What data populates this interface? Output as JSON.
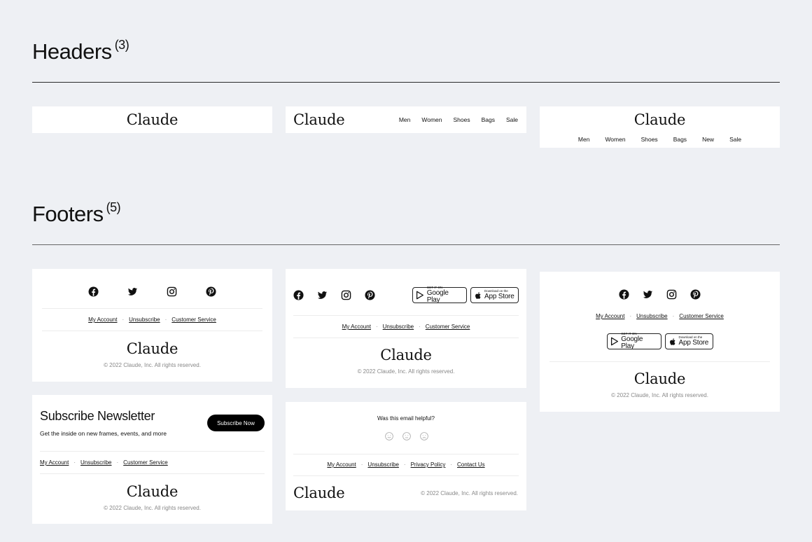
{
  "headers_section": {
    "title": "Headers",
    "count": "(3)"
  },
  "footers_section": {
    "title": "Footers",
    "count": "(5)"
  },
  "brand": "Claude",
  "header2_nav": [
    "Men",
    "Women",
    "Shoes",
    "Bags",
    "Sale"
  ],
  "header3_nav": [
    "Men",
    "Women",
    "Shoes",
    "Bags",
    "New",
    "Sale"
  ],
  "social_icons": [
    "facebook-icon",
    "twitter-icon",
    "instagram-icon",
    "pinterest-icon"
  ],
  "links_basic": [
    "My Account",
    "Unsubscribe",
    "Customer Service"
  ],
  "links_extended": [
    "My Account",
    "Unsubscribe",
    "Privacy Policy",
    "Contact Us"
  ],
  "copyright": "© 2022 Claude, Inc. All rights reserved.",
  "google_play": {
    "small": "GET IT ON",
    "big": "Google Play"
  },
  "app_store": {
    "small": "Download on the",
    "big": "App Store"
  },
  "newsletter": {
    "title": "Subscribe Newsletter",
    "subtitle": "Get the inside on new frames, events, and more",
    "button": "Subscribe Now"
  },
  "feedback": {
    "question": "Was this email helpful?"
  },
  "colors": {
    "background": "#eef0f4",
    "card": "#ffffff",
    "text": "#111111",
    "muted": "#888888"
  }
}
